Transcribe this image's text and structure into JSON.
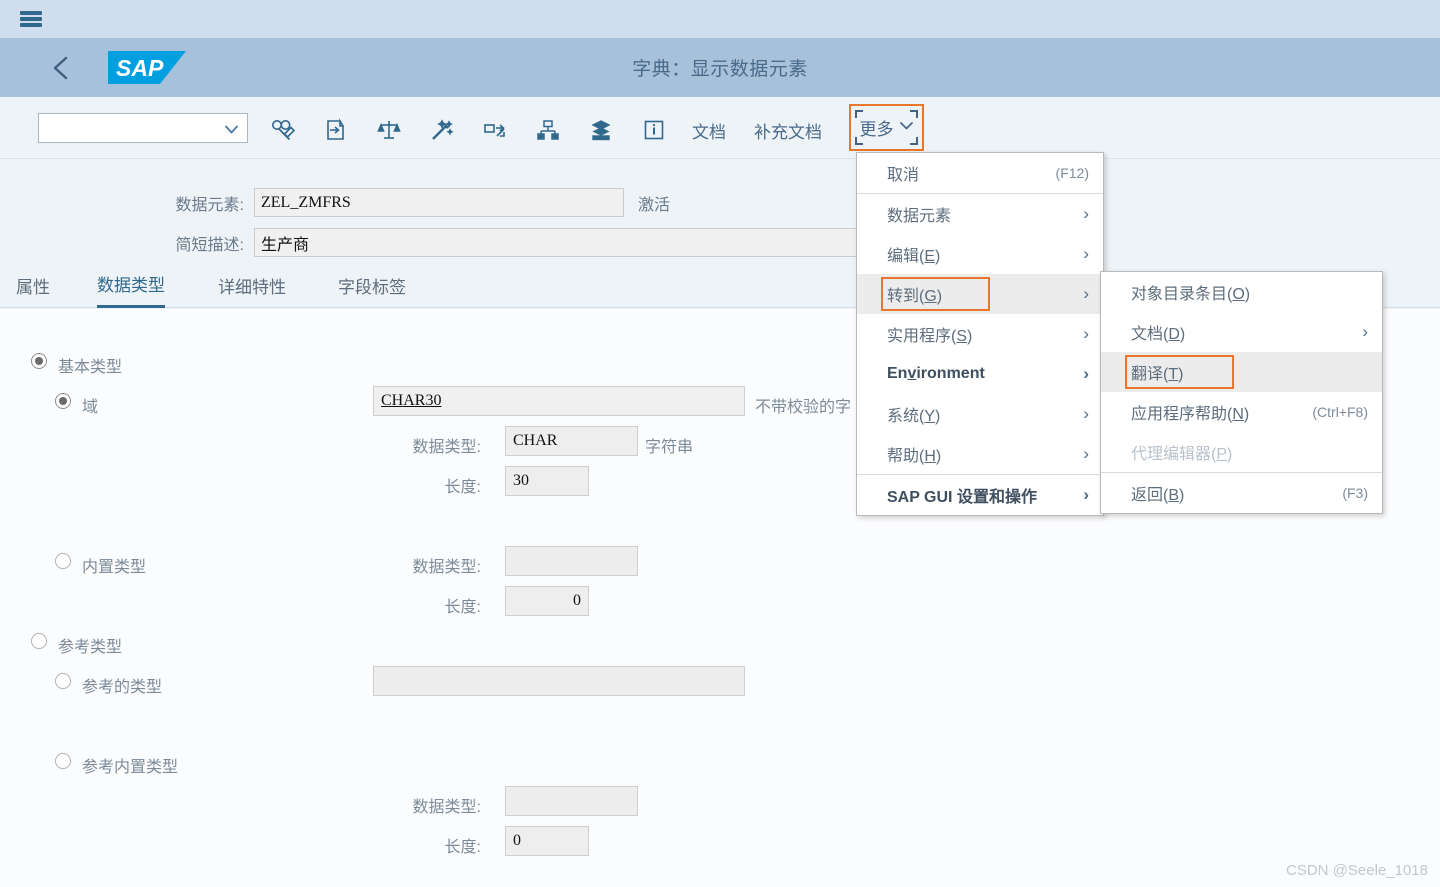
{
  "shell": {
    "menu_icon": "hamburger-icon"
  },
  "header": {
    "back_icon": "chevron-left-icon",
    "logo_text": "SAP",
    "title": "字典：显示数据元素"
  },
  "toolbar": {
    "select_value": "",
    "select_placeholder": "",
    "chevron_icon": "chevron-down-icon",
    "icons": [
      {
        "name": "edit-glasses-icon",
        "tooltip": "显示 <-> 更改"
      },
      {
        "name": "enter-document-icon",
        "tooltip": "其它对象"
      },
      {
        "name": "scales-compare-icon",
        "tooltip": "比较"
      },
      {
        "name": "magic-wand-icon",
        "tooltip": "检查"
      },
      {
        "name": "where-used-icon",
        "tooltip": "使用位置列表"
      },
      {
        "name": "hierarchy-icon",
        "tooltip": "层次"
      },
      {
        "name": "database-stack-icon",
        "tooltip": "数据库对象"
      },
      {
        "name": "info-icon",
        "tooltip": "信息"
      }
    ],
    "text_buttons": [
      {
        "label": "文档"
      },
      {
        "label": "补充文档"
      }
    ],
    "more_label": "更多",
    "more_focused": true
  },
  "form_header": {
    "fields": [
      {
        "label": "数据元素:",
        "value": "ZEL_ZMFRS",
        "status": "激活"
      },
      {
        "label": "简短描述:",
        "value": "生产商",
        "status": ""
      }
    ]
  },
  "tabs": [
    {
      "label": "属性",
      "active": false
    },
    {
      "label": "数据类型",
      "active": true
    },
    {
      "label": "详细特性",
      "active": false
    },
    {
      "label": "字段标签",
      "active": false
    }
  ],
  "data_type_panel": {
    "groups": [
      {
        "name": "elementary-type",
        "label": "基本类型",
        "selected": true,
        "options": [
          {
            "name": "domain",
            "label": "域",
            "selected": true,
            "main_value": "CHAR30",
            "side_note": "不带校验的字",
            "fields": [
              {
                "label": "数据类型:",
                "value": "CHAR",
                "side": "字符串"
              },
              {
                "label": "长度:",
                "value": "30",
                "side": ""
              }
            ]
          },
          {
            "name": "builtin-type",
            "label": "内置类型",
            "selected": false,
            "main_value": "",
            "side_note": "",
            "fields": [
              {
                "label": "数据类型:",
                "value": "",
                "side": ""
              },
              {
                "label": "长度:",
                "value": "0",
                "side": ""
              }
            ]
          }
        ]
      },
      {
        "name": "reference-type",
        "label": "参考类型",
        "selected": false,
        "options": [
          {
            "name": "referenced-type",
            "label": "参考的类型",
            "selected": false,
            "main_value": "",
            "side_note": "",
            "fields": []
          },
          {
            "name": "reference-builtin-type",
            "label": "参考内置类型",
            "selected": false,
            "main_value": "",
            "side_note": "",
            "fields": [
              {
                "label": "数据类型:",
                "value": "",
                "side": ""
              },
              {
                "label": "长度:",
                "value": "0",
                "side": ""
              }
            ]
          }
        ]
      }
    ]
  },
  "more_menu": {
    "items": [
      {
        "label": "取消",
        "accel": "",
        "shortcut": "(F12)",
        "arrow": false,
        "bold": false,
        "disabled": false,
        "highlight": false,
        "focus": false,
        "sep_after": true
      },
      {
        "label": "数据元素",
        "accel": "",
        "shortcut": "",
        "arrow": true,
        "bold": false,
        "disabled": false,
        "highlight": false,
        "focus": false,
        "sep_after": false
      },
      {
        "label": "编辑",
        "accel": "E",
        "shortcut": "",
        "arrow": true,
        "bold": false,
        "disabled": false,
        "highlight": false,
        "focus": false,
        "sep_after": false
      },
      {
        "label": "转到",
        "accel": "G",
        "shortcut": "",
        "arrow": true,
        "bold": false,
        "disabled": false,
        "highlight": true,
        "focus": true,
        "sep_after": false
      },
      {
        "label": "实用程序",
        "accel": "S",
        "shortcut": "",
        "arrow": true,
        "bold": false,
        "disabled": false,
        "highlight": false,
        "focus": false,
        "sep_after": false
      },
      {
        "label": "Environment",
        "accel": "v",
        "shortcut": "",
        "arrow": true,
        "bold": true,
        "disabled": false,
        "highlight": false,
        "focus": false,
        "sep_after": false
      },
      {
        "label": "系统",
        "accel": "Y",
        "shortcut": "",
        "arrow": true,
        "bold": false,
        "disabled": false,
        "highlight": false,
        "focus": false,
        "sep_after": false
      },
      {
        "label": "帮助",
        "accel": "H",
        "shortcut": "",
        "arrow": true,
        "bold": false,
        "disabled": false,
        "highlight": false,
        "focus": false,
        "sep_after": true
      },
      {
        "label": "SAP GUI 设置和操作",
        "accel": "",
        "shortcut": "",
        "arrow": true,
        "bold": true,
        "disabled": false,
        "highlight": false,
        "focus": false,
        "sep_after": false
      }
    ]
  },
  "goto_submenu": {
    "items": [
      {
        "label": "对象目录条目",
        "accel": "O",
        "shortcut": "",
        "arrow": false,
        "bold": false,
        "disabled": false,
        "highlight": false,
        "focus": false,
        "sep_after": false
      },
      {
        "label": "文档",
        "accel": "D",
        "shortcut": "",
        "arrow": true,
        "bold": false,
        "disabled": false,
        "highlight": false,
        "focus": false,
        "sep_after": false
      },
      {
        "label": "翻译",
        "accel": "T",
        "shortcut": "",
        "arrow": false,
        "bold": false,
        "disabled": false,
        "highlight": true,
        "focus": true,
        "sep_after": false
      },
      {
        "label": "应用程序帮助",
        "accel": "N",
        "shortcut": "(Ctrl+F8)",
        "arrow": false,
        "bold": false,
        "disabled": false,
        "highlight": false,
        "focus": false,
        "sep_after": false
      },
      {
        "label": "代理编辑器",
        "accel": "P",
        "shortcut": "",
        "arrow": false,
        "bold": false,
        "disabled": true,
        "highlight": false,
        "focus": false,
        "sep_after": true
      },
      {
        "label": "返回",
        "accel": "B",
        "shortcut": "(F3)",
        "arrow": false,
        "bold": false,
        "disabled": false,
        "highlight": false,
        "focus": false,
        "sep_after": false
      }
    ]
  },
  "watermark": "CSDN @Seele_1018",
  "colors": {
    "shellbar": "#cfdded",
    "header": "#a8c1da",
    "accent": "#31688e",
    "focus": "#e8762b",
    "logo": "#00a0e0",
    "panel": "#fbfcfd"
  }
}
